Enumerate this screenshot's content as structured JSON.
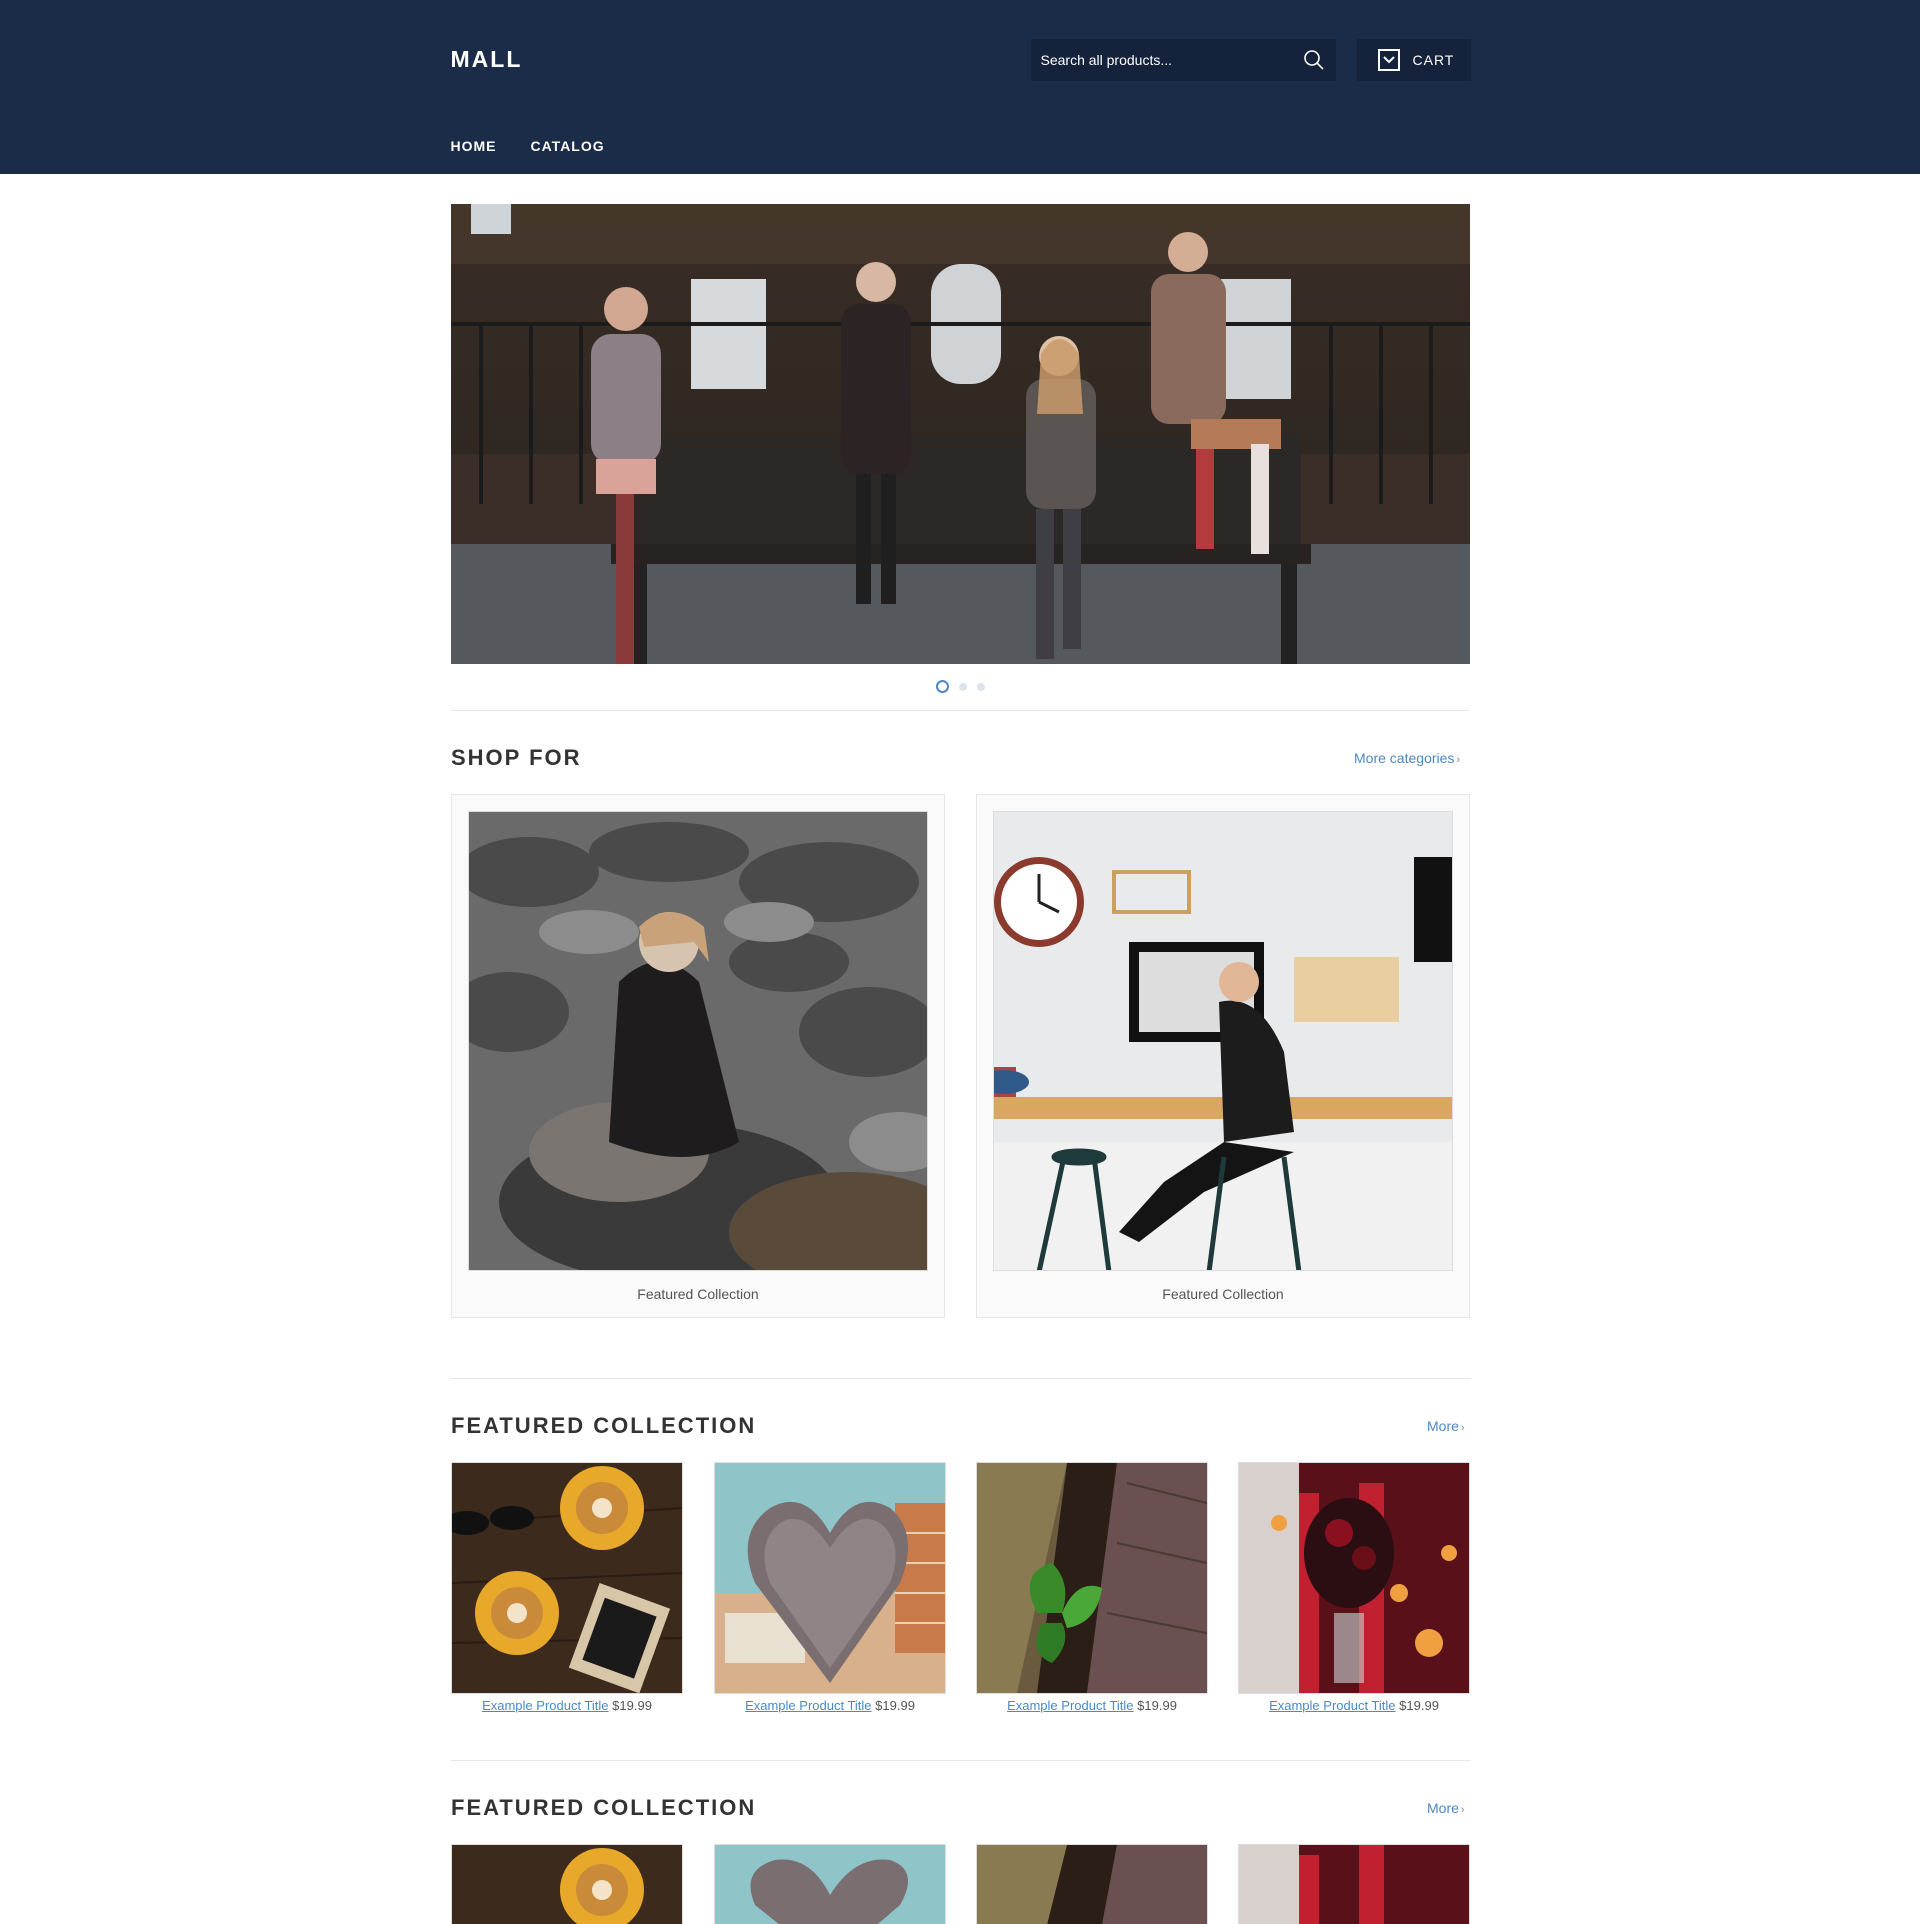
{
  "header": {
    "logo": "MALL",
    "search_placeholder": "Search all products...",
    "cart_label": "CART",
    "nav": [
      "HOME",
      "CATALOG"
    ]
  },
  "slider": {
    "dots": 3,
    "active_dot": 1
  },
  "shop_for": {
    "title": "SHOP FOR",
    "more_label": "More categories",
    "cards": [
      {
        "caption": "Featured Collection"
      },
      {
        "caption": "Featured Collection"
      }
    ]
  },
  "featured_1": {
    "title": "FEATURED COLLECTION",
    "more_label": "More",
    "products": [
      {
        "title": "Example Product Title",
        "price": "$19.99"
      },
      {
        "title": "Example Product Title",
        "price": "$19.99"
      },
      {
        "title": "Example Product Title",
        "price": "$19.99"
      },
      {
        "title": "Example Product Title",
        "price": "$19.99"
      }
    ]
  },
  "featured_2": {
    "title": "FEATURED COLLECTION",
    "more_label": "More"
  },
  "colors": {
    "header_bg": "#1b2c48",
    "accent": "#4d88c4"
  }
}
